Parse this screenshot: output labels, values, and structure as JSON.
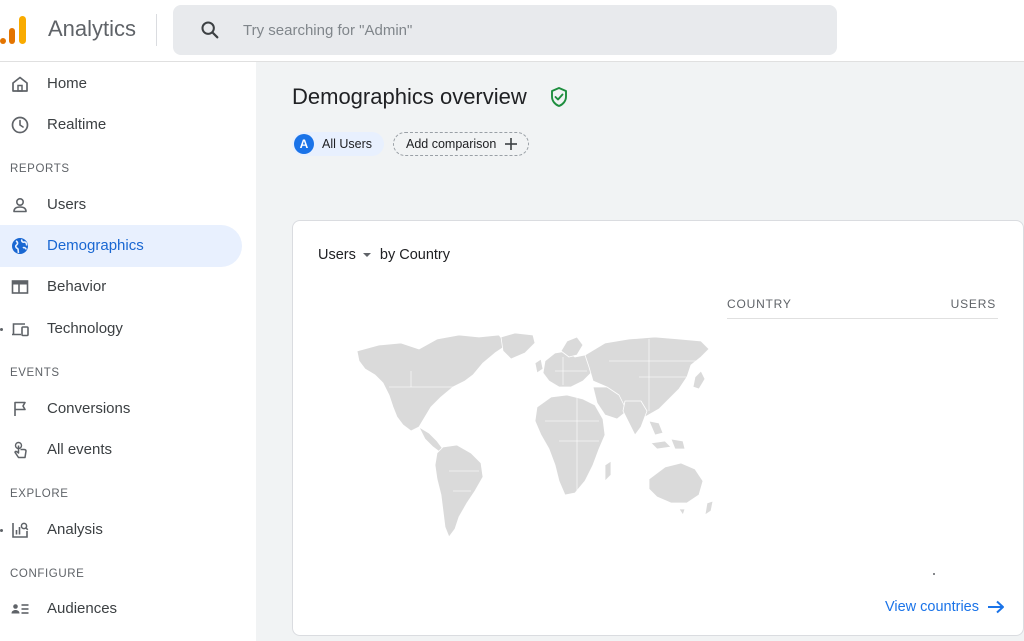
{
  "header": {
    "app_title": "Analytics",
    "search_placeholder": "Try searching for \"Admin\""
  },
  "sidebar": {
    "items_top": [
      {
        "label": "Home",
        "icon": "home-icon"
      },
      {
        "label": "Realtime",
        "icon": "clock-icon"
      }
    ],
    "sections": [
      {
        "title": "REPORTS",
        "items": [
          {
            "label": "Users",
            "icon": "person-icon"
          },
          {
            "label": "Demographics",
            "icon": "globe-icon",
            "active": true
          },
          {
            "label": "Behavior",
            "icon": "web-icon"
          },
          {
            "label": "Technology",
            "icon": "devices-icon"
          }
        ]
      },
      {
        "title": "EVENTS",
        "items": [
          {
            "label": "Conversions",
            "icon": "flag-icon"
          },
          {
            "label": "All events",
            "icon": "touch-icon"
          }
        ]
      },
      {
        "title": "EXPLORE",
        "items": [
          {
            "label": "Analysis",
            "icon": "analysis-icon"
          }
        ]
      },
      {
        "title": "CONFIGURE",
        "items": [
          {
            "label": "Audiences",
            "icon": "audiences-icon"
          }
        ]
      }
    ]
  },
  "main": {
    "page_title": "Demographics overview",
    "chips": {
      "all_users_avatar": "A",
      "all_users": "All Users",
      "add_comparison": "Add comparison"
    },
    "card": {
      "metric": "Users",
      "dimension": "by Country",
      "col_country": "COUNTRY",
      "col_users": "USERS",
      "view_link": "View countries"
    }
  },
  "colors": {
    "accent": "#1a73e8",
    "active_bg": "#e8f0fe",
    "main_bg": "#f1f3f4",
    "map_fill": "#dadada",
    "verified": "#1e8e3e",
    "logo_orange": "#f9ab00",
    "logo_dark_orange": "#e37400"
  }
}
